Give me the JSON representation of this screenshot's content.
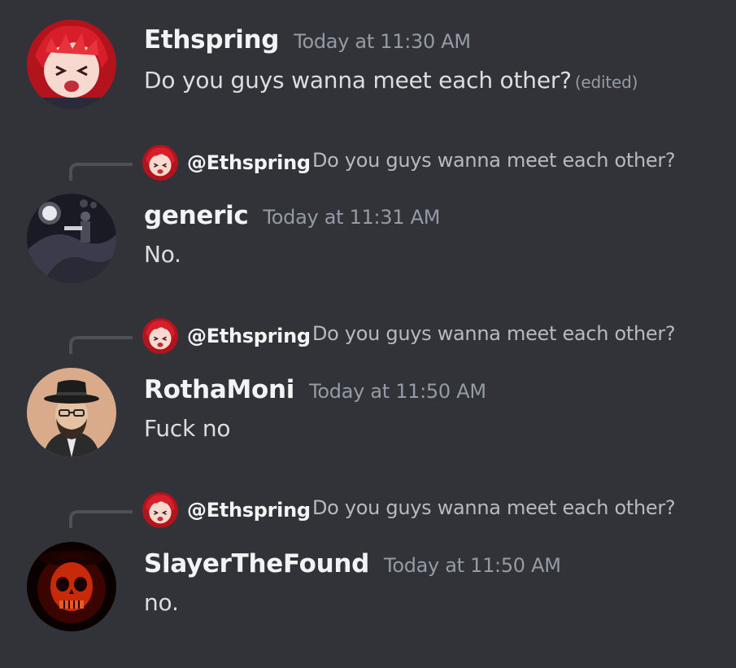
{
  "messages": [
    {
      "username": "Ethspring",
      "timestamp": "Today at 11:30 AM",
      "content": "Do you guys wanna meet each other?",
      "edited_label": "(edited)",
      "avatar_icon": "red-hair-anime-avatar-icon"
    },
    {
      "reply": {
        "mention": "@Ethspring",
        "preview": "Do you guys wanna meet each other?",
        "avatar_icon": "red-hair-anime-avatar-icon"
      },
      "username": "generic",
      "timestamp": "Today at 11:31 AM",
      "content": "No.",
      "avatar_icon": "dark-figure-avatar-icon"
    },
    {
      "reply": {
        "mention": "@Ethspring",
        "preview": "Do you guys wanna meet each other?",
        "avatar_icon": "red-hair-anime-avatar-icon"
      },
      "username": "RothaMoni",
      "timestamp": "Today at 11:50 AM",
      "content": "Fuck no",
      "avatar_icon": "hat-beard-man-avatar-icon"
    },
    {
      "reply": {
        "mention": "@Ethspring",
        "preview": "Do you guys wanna meet each other?",
        "avatar_icon": "red-hair-anime-avatar-icon"
      },
      "username": "SlayerTheFound",
      "timestamp": "Today at 11:50 AM",
      "content": "no.",
      "avatar_icon": "red-skull-avatar-icon"
    }
  ],
  "colors": {
    "background": "#313338",
    "username": "#f2f3f5",
    "text": "#dbdee1",
    "muted": "#949ba4",
    "reply_spine": "#4e5058"
  }
}
